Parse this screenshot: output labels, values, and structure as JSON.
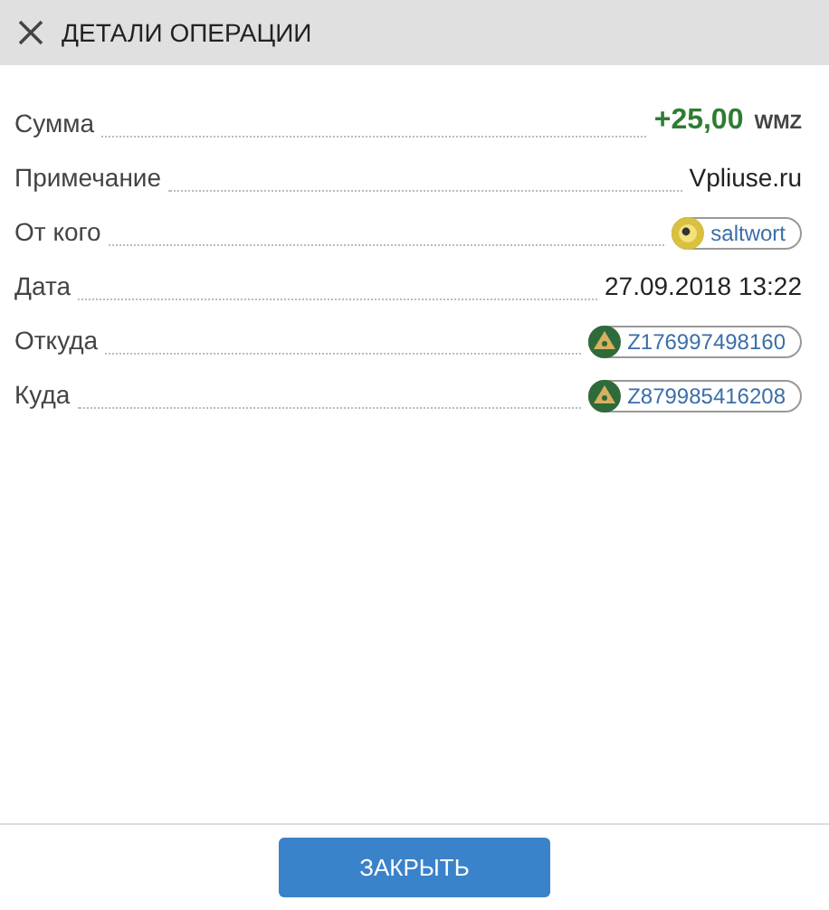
{
  "header": {
    "title": "ДЕТАЛИ ОПЕРАЦИИ"
  },
  "rows": [
    {
      "kind": "amount",
      "label": "Сумма",
      "value": "+25,00",
      "currency": "WMZ"
    },
    {
      "kind": "text",
      "label": "Примечание",
      "value": "Vpliuse.ru"
    },
    {
      "kind": "user",
      "label": "От кого",
      "value": "saltwort"
    },
    {
      "kind": "text",
      "label": "Дата",
      "value": "27.09.2018 13:22"
    },
    {
      "kind": "wallet",
      "label": "Откуда",
      "value": "Z176997498160"
    },
    {
      "kind": "wallet",
      "label": "Куда",
      "value": "Z879985416208"
    }
  ],
  "footer": {
    "button": "ЗАКРЫТЬ"
  }
}
